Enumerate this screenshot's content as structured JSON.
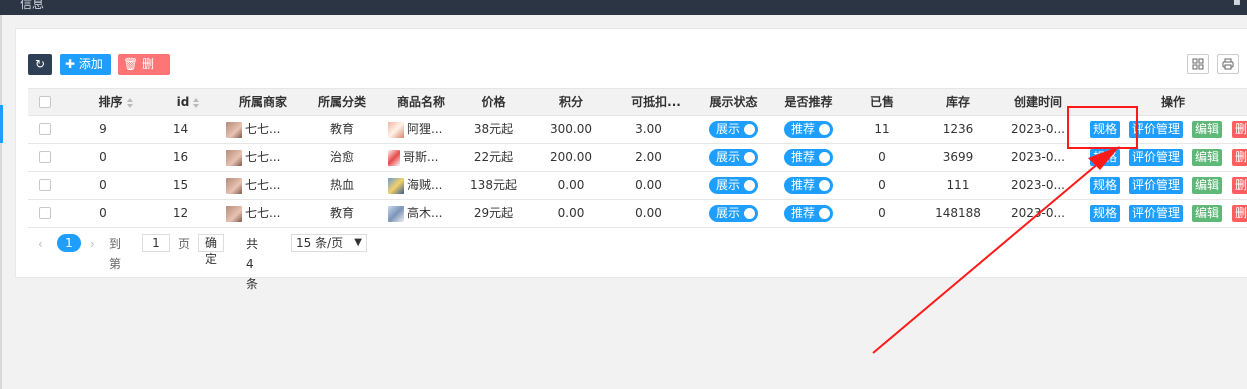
{
  "window": {
    "title": "信息",
    "control": "▪"
  },
  "toolbar": {
    "refresh_icon": "↻",
    "add_label": "✚ 添加",
    "delete_label": "🗑 删除",
    "filter_icon": "columns-icon",
    "print_icon": "print-icon"
  },
  "table": {
    "headers": [
      "排序",
      "id",
      "所属商家",
      "所属分类",
      "商品名称",
      "价格",
      "积分",
      "可抵扣...",
      "展示状态",
      "是否推荐",
      "已售",
      "库存",
      "创建时间",
      "操作"
    ],
    "rows": [
      {
        "sort": "9",
        "id": "14",
        "merchant": "七七...",
        "category": "教育",
        "name": "阿狸...",
        "price": "38元起",
        "points": "300.00",
        "deduct": "3.00",
        "show": "展示",
        "recommend": "推荐",
        "sold": "11",
        "stock": "1236",
        "created": "2023-0..."
      },
      {
        "sort": "0",
        "id": "16",
        "merchant": "七七...",
        "category": "治愈",
        "name": "哥斯...",
        "price": "22元起",
        "points": "200.00",
        "deduct": "2.00",
        "show": "展示",
        "recommend": "推荐",
        "sold": "0",
        "stock": "3699",
        "created": "2023-0..."
      },
      {
        "sort": "0",
        "id": "15",
        "merchant": "七七...",
        "category": "热血",
        "name": "海贼...",
        "price": "138元起",
        "points": "0.00",
        "deduct": "0.00",
        "show": "展示",
        "recommend": "推荐",
        "sold": "0",
        "stock": "111",
        "created": "2023-0..."
      },
      {
        "sort": "0",
        "id": "12",
        "merchant": "七七...",
        "category": "教育",
        "name": "高木...",
        "price": "29元起",
        "points": "0.00",
        "deduct": "0.00",
        "show": "展示",
        "recommend": "推荐",
        "sold": "0",
        "stock": "148188",
        "created": "2023-0..."
      }
    ],
    "ops": {
      "spec": "规格",
      "review": "评价管理",
      "edit": "编辑",
      "delete": "删"
    }
  },
  "pager": {
    "prev": "‹",
    "current": "1",
    "next": "›",
    "goto_label": "到第",
    "goto_value": "1",
    "page_unit": "页",
    "confirm": "确定",
    "total": "共 4 条",
    "page_size": "15 条/页",
    "dropdown": "▼"
  },
  "colors": {
    "accent": "#1e9fff",
    "edit": "#5fb878",
    "danger": "#ff5e5e",
    "annotation": "#ff1a1a"
  }
}
